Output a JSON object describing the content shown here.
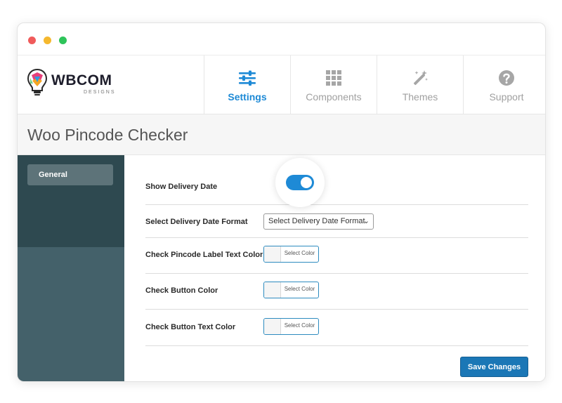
{
  "window_controls": [
    "close",
    "minimize",
    "maximize"
  ],
  "logo": {
    "name": "WBCOM",
    "sub": "DESIGNS"
  },
  "nav": {
    "tabs": [
      {
        "label": "Settings",
        "icon": "sliders-icon",
        "active": true
      },
      {
        "label": "Components",
        "icon": "grid-icon",
        "active": false
      },
      {
        "label": "Themes",
        "icon": "magic-wand-icon",
        "active": false
      },
      {
        "label": "Support",
        "icon": "help-icon",
        "active": false
      }
    ]
  },
  "page": {
    "title": "Woo Pincode Checker"
  },
  "sidebar": {
    "items": [
      {
        "label": "General",
        "active": true
      }
    ]
  },
  "settings": {
    "show_delivery_date": {
      "label": "Show Delivery Date",
      "enabled": true
    },
    "delivery_date_format": {
      "label": "Select Delivery Date Format",
      "value": "Select Delivery Date Format"
    },
    "label_text_color": {
      "label": "Check Pincode Label Text Color",
      "button": "Select Color"
    },
    "button_color": {
      "label": "Check Button Color",
      "button": "Select Color"
    },
    "button_text_color": {
      "label": "Check Button Text Color",
      "button": "Select Color"
    }
  },
  "actions": {
    "save_label": "Save Changes"
  },
  "colors": {
    "accent": "#1e8ad6",
    "sidebar_dark": "#2e4950",
    "sidebar": "#44616a",
    "save_button": "#1b77b6"
  }
}
